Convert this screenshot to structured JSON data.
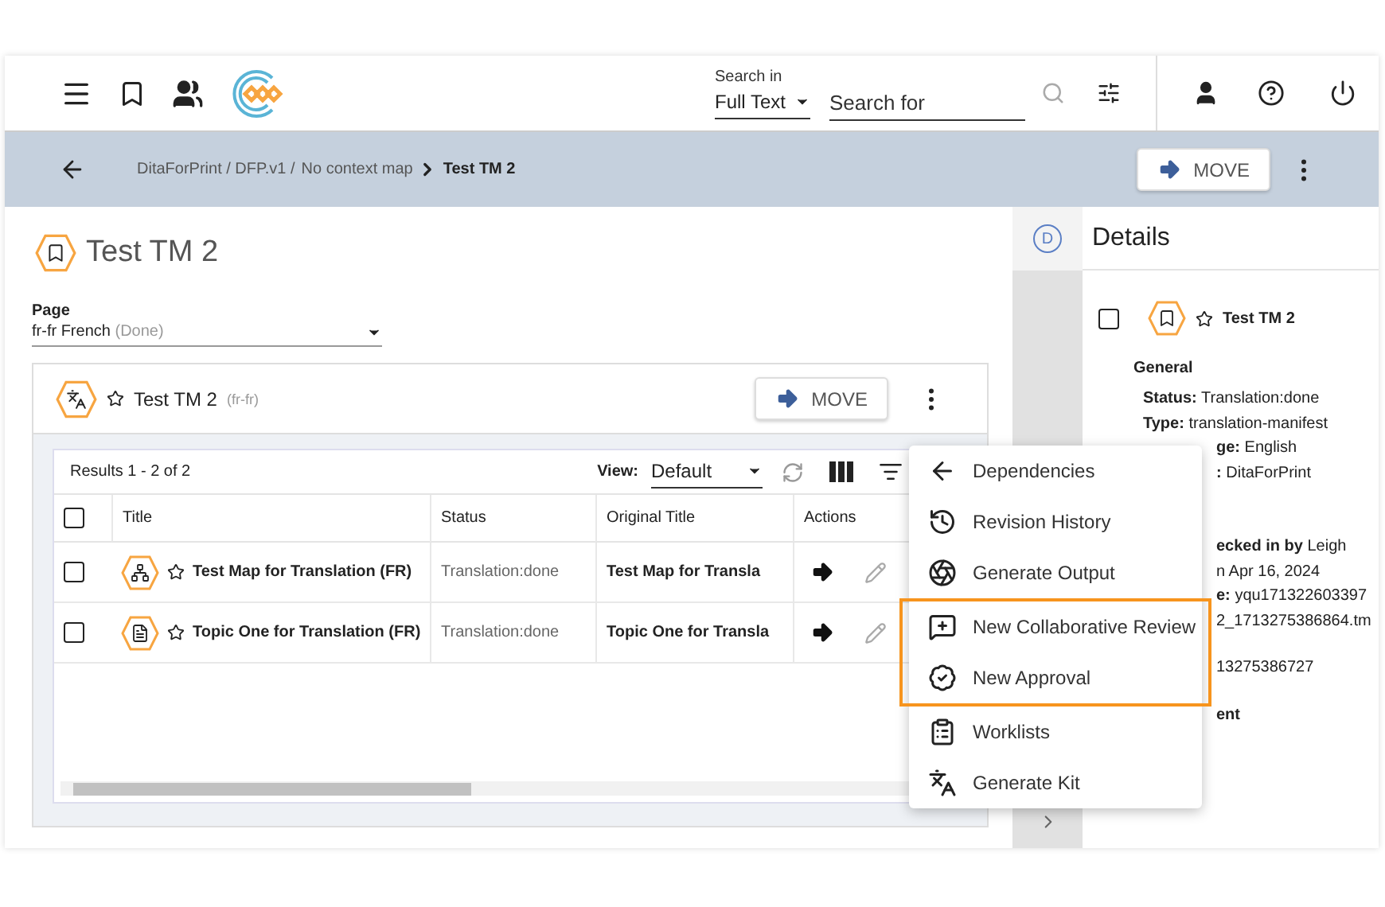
{
  "header": {
    "search_label": "Search in",
    "search_scope": "Full Text",
    "search_placeholder": "Search for"
  },
  "breadcrumb": {
    "path": [
      "DitaForPrint / DFP.v1 /",
      "No context map"
    ],
    "current": "Test TM 2",
    "move_label": "MOVE"
  },
  "page": {
    "title": "Test TM 2",
    "field_label": "Page",
    "field_value": "fr-fr French",
    "field_status": "(Done)"
  },
  "card": {
    "title": "Test TM 2",
    "locale": "(fr-fr)",
    "move_label": "MOVE",
    "starred": false,
    "results": "Results 1 - 2 of 2",
    "view_label": "View:",
    "view_value": "Default",
    "columns": [
      "Title",
      "Status",
      "Original Title",
      "Actions"
    ],
    "all_checked": false,
    "rows": [
      {
        "kind": "map",
        "title": "Test Map for Translation (FR)",
        "status": "Translation:done",
        "original": "Test Map for Transla",
        "checked": false,
        "starred": false
      },
      {
        "kind": "topic",
        "title": "Topic One for Translation (FR)",
        "status": "Translation:done",
        "original": "Topic One for Transla",
        "checked": false,
        "starred": false
      }
    ]
  },
  "details": {
    "badge": "D",
    "title": "Details",
    "item_title": "Test TM 2",
    "checked": false,
    "starred": false,
    "section": "General",
    "groups": [
      [
        {
          "kind": "full",
          "label": "Status:",
          "value": "Translation:done"
        },
        {
          "kind": "full",
          "label": "Type:",
          "value": "translation-manifest"
        },
        {
          "kind": "behind_menu",
          "label": "ge:",
          "value": "English"
        },
        {
          "kind": "behind_menu",
          "label": ":",
          "value": "DitaForPrint"
        }
      ],
      [
        {
          "kind": "behind_menu",
          "label": "ecked in by",
          "value": "Leigh"
        },
        {
          "kind": "behind_menu",
          "value": "n Apr 16, 2024"
        },
        {
          "kind": "behind_menu",
          "label": "e:",
          "value": "yqu171322603397"
        },
        {
          "kind": "behind_menu",
          "value": "2_1713275386864.tm"
        }
      ],
      [
        {
          "kind": "behind_menu",
          "value": "13275386727"
        }
      ],
      [
        {
          "kind": "behind_menu",
          "label": "ent"
        }
      ]
    ]
  },
  "menu": {
    "items": [
      {
        "kind": "dependencies",
        "label": "Dependencies",
        "highlighted": false
      },
      {
        "kind": "history",
        "label": "Revision History",
        "highlighted": false
      },
      {
        "kind": "output",
        "label": "Generate Output",
        "highlighted": false
      },
      {
        "kind": "review",
        "label": "New Collaborative Review",
        "highlighted": true
      },
      {
        "kind": "approval",
        "label": "New Approval",
        "highlighted": true
      },
      {
        "kind": "worklists",
        "label": "Worklists",
        "highlighted": false
      },
      {
        "kind": "kit",
        "label": "Generate Kit",
        "highlighted": false
      }
    ]
  }
}
